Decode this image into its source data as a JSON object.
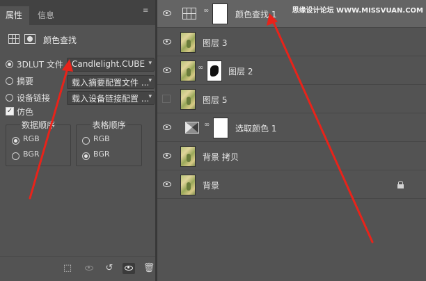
{
  "tabs": [
    {
      "label": "属性",
      "active": true
    },
    {
      "label": "信息",
      "active": false
    }
  ],
  "properties": {
    "title": "颜色查找",
    "options": [
      {
        "label": "3DLUT 文件",
        "selected": true,
        "value": "Candlelight.CUBE"
      },
      {
        "label": "摘要",
        "selected": false,
        "value": "载入摘要配置文件 ..."
      },
      {
        "label": "设备链接",
        "selected": false,
        "value": "载入设备链接配置 ..."
      }
    ],
    "dither": {
      "label": "仿色",
      "checked": true
    },
    "data_order": {
      "title": "数据顺序",
      "options": [
        "RGB",
        "BGR"
      ],
      "selected": "RGB"
    },
    "table_order": {
      "title": "表格顺序",
      "options": [
        "RGB",
        "BGR"
      ],
      "selected": "BGR"
    }
  },
  "layers": [
    {
      "name": "颜色查找 1",
      "kind": "adjustment-lut",
      "visible": true,
      "selected": true,
      "mask": "white"
    },
    {
      "name": "图层 3",
      "kind": "photo",
      "visible": true
    },
    {
      "name": "图层 2",
      "kind": "photo",
      "visible": true,
      "mask": "black-shape"
    },
    {
      "name": "图层 5",
      "kind": "photo",
      "visible": false
    },
    {
      "name": "选取颜色 1",
      "kind": "adjustment-selective",
      "visible": true,
      "mask": "white"
    },
    {
      "name": "背景 拷贝",
      "kind": "photo",
      "visible": true
    },
    {
      "name": "背景",
      "kind": "photo",
      "visible": true,
      "locked": true
    }
  ],
  "watermark": "思缘设计论坛 WWW.MISSVUAN.COM",
  "colors": {
    "panel_bg": "#535353",
    "selected_row": "#646464",
    "arrow": "#e8231a"
  },
  "icons": {
    "panel_menu": "menu-lines-icon",
    "bottom": [
      "clip-to-layer-icon",
      "view-previous-icon",
      "reset-icon",
      "toggle-visibility-icon",
      "delete-icon"
    ]
  }
}
